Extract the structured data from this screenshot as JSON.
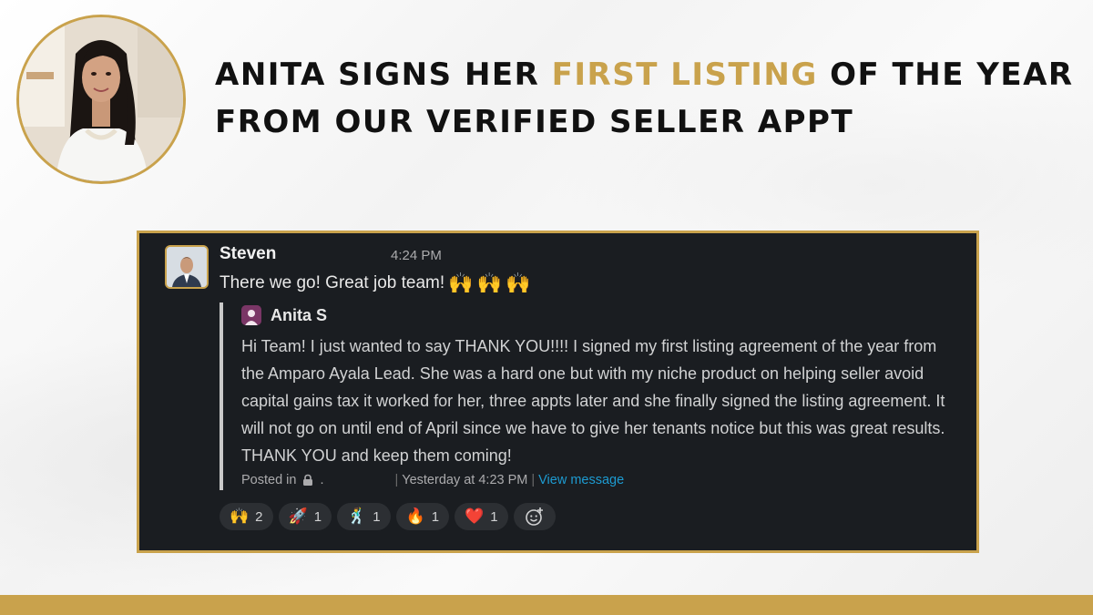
{
  "headline": {
    "part1": "ANITA SIGNS HER ",
    "highlight": "FIRST LISTING",
    "part2": " OF THE YEAR FROM OUR VERIFIED SELLER APPT"
  },
  "colors": {
    "gold": "#c9a24c",
    "card_bg": "#1a1d21",
    "link": "#1d9bd1"
  },
  "message": {
    "sender": "Steven",
    "time": "4:24 PM",
    "text": "There we go! Great job team!",
    "inline_emoji": [
      "🙌",
      "🙌",
      "🙌"
    ]
  },
  "quote": {
    "author": "Anita S",
    "body": "Hi Team! I just wanted to say THANK YOU!!!! I signed my first listing agreement of the year from the Amparo Ayala Lead. She was a hard one but with my niche product on helping seller avoid capital gains tax it worked for her, three appts later and she finally signed the listing agreement. It will not go on until end of April since we have to give her tenants notice but this was great results. THANK YOU and keep them coming!",
    "posted_in": "Posted in",
    "posted_time": "Yesterday at 4:23 PM",
    "view_link": "View message",
    "separator": "|"
  },
  "reactions": [
    {
      "emoji": "🙌",
      "count": "2",
      "icon": "raised-hands-icon"
    },
    {
      "emoji": "🚀",
      "count": "1",
      "icon": "rocket-icon"
    },
    {
      "emoji": "🕺",
      "count": "1",
      "icon": "dancing-icon"
    },
    {
      "emoji": "🔥",
      "count": "1",
      "icon": "fire-icon"
    },
    {
      "emoji": "❤️",
      "count": "1",
      "icon": "heart-icon"
    }
  ]
}
